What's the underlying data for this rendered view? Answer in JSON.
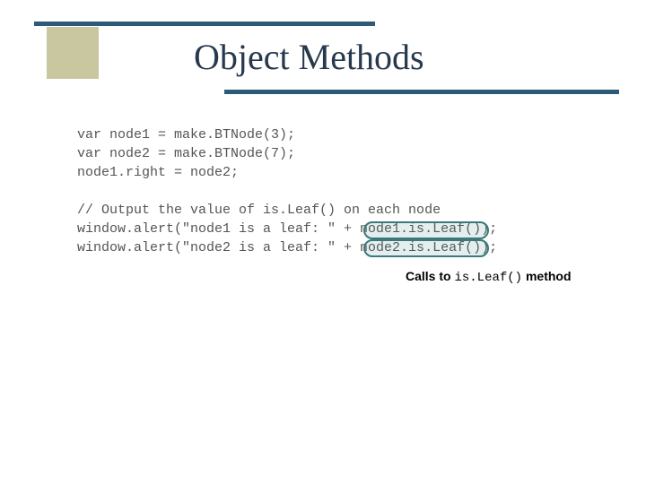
{
  "title": "Object Methods",
  "code": {
    "line1": "var node1 = make.BTNode(3);",
    "line2": "var node2 = make.BTNode(7);",
    "line3": "node1.right = node2;",
    "blank": "",
    "comment": "// Output the value of is.Leaf() on each node",
    "line4": "window.alert(\"node1 is a leaf: \" + node1.is.Leaf());",
    "line5": "window.alert(\"node2 is a leaf: \" + node2.is.Leaf());"
  },
  "caption": {
    "before": "Calls to ",
    "code": "is.Leaf()",
    "after": " method"
  }
}
